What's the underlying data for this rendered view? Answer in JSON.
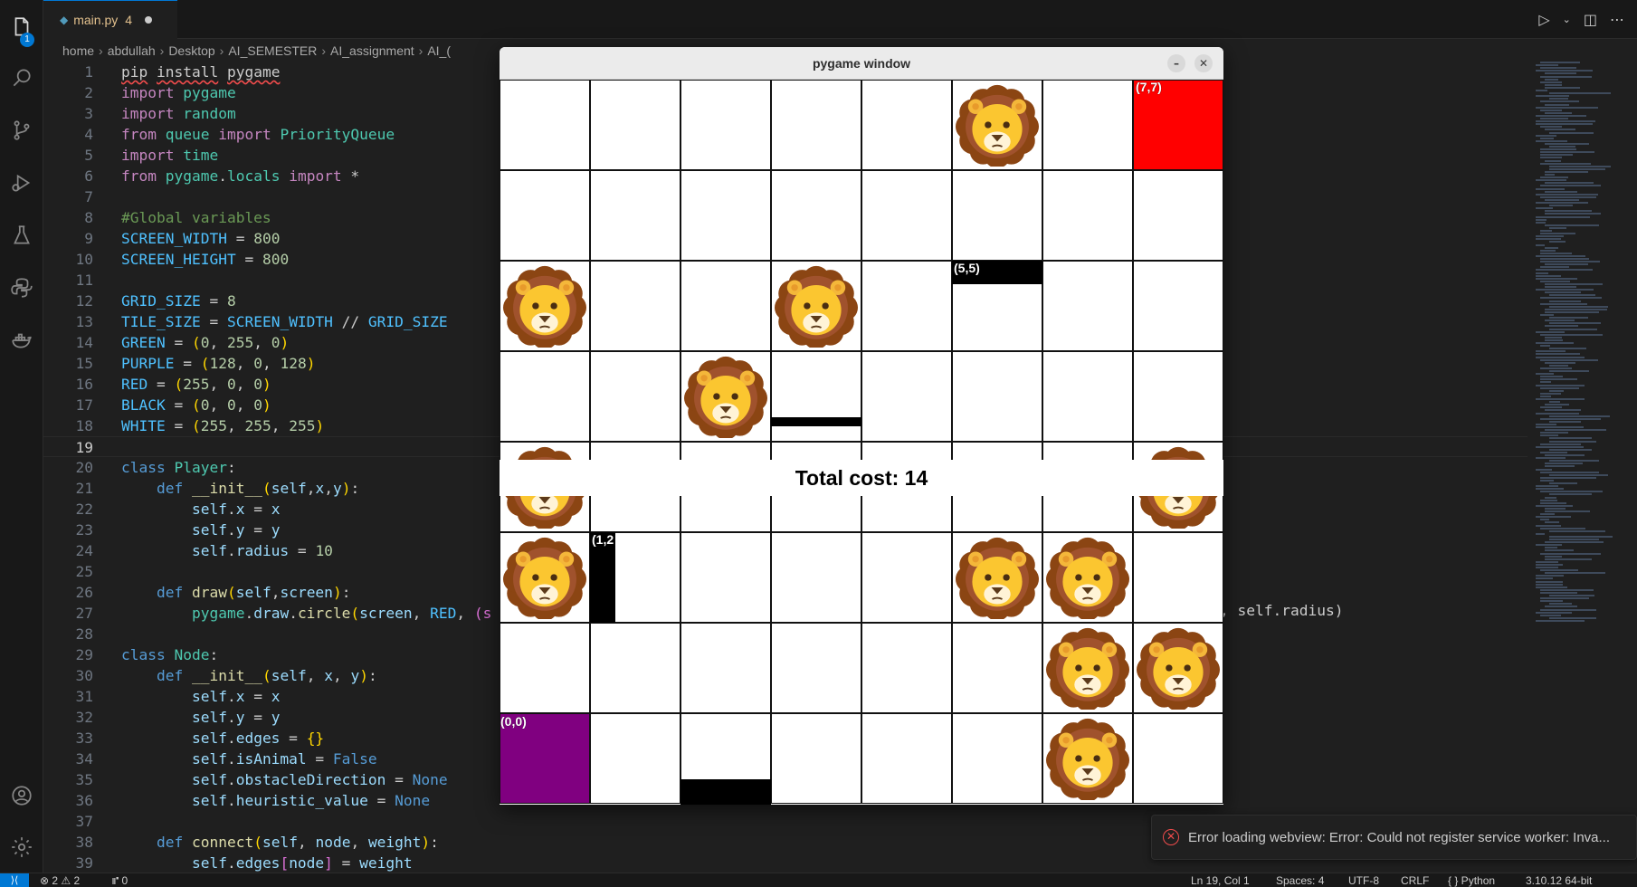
{
  "editor": {
    "tab_name": "main.py",
    "tab_problem_count": "4",
    "breadcrumb": [
      "home",
      "abdullah",
      "Desktop",
      "AI_SEMESTER",
      "AI_assignment",
      "AI_("
    ],
    "code_tail_text": ", self.radius)",
    "current_line": 19
  },
  "activity_bar": {
    "explorer_badge": "1",
    "items": [
      "files-icon",
      "search-icon",
      "source-control-icon",
      "run-debug-icon",
      "testing-icon",
      "python-icon",
      "docker-icon",
      "account-icon",
      "settings-gear-icon"
    ]
  },
  "pygame": {
    "window_title": "pygame window",
    "minimize_glyph": "–",
    "close_glyph": "✕",
    "total_cost_text": "Total cost: 14",
    "goal_label": "(7,7)",
    "start_label": "(0,0)",
    "obstacle_labels": [
      "(5,5)",
      "(1,2"
    ],
    "colors": {
      "goal": "#ff0000",
      "start": "#800080",
      "obstacle": "#000000",
      "grid_line": "#111111"
    }
  },
  "notification": {
    "text": "Error loading webview: Error: Could not register service worker: Inva..."
  },
  "status_bar": {
    "problems": "⊗ 2  ⚠ 2",
    "ports": "⑈ 0",
    "position": "Ln 19, Col 1",
    "spaces": "Spaces: 4",
    "encoding": "UTF-8",
    "eol": "CRLF",
    "language": "{ } Python",
    "interpreter": "3.10.12 64-bit"
  }
}
